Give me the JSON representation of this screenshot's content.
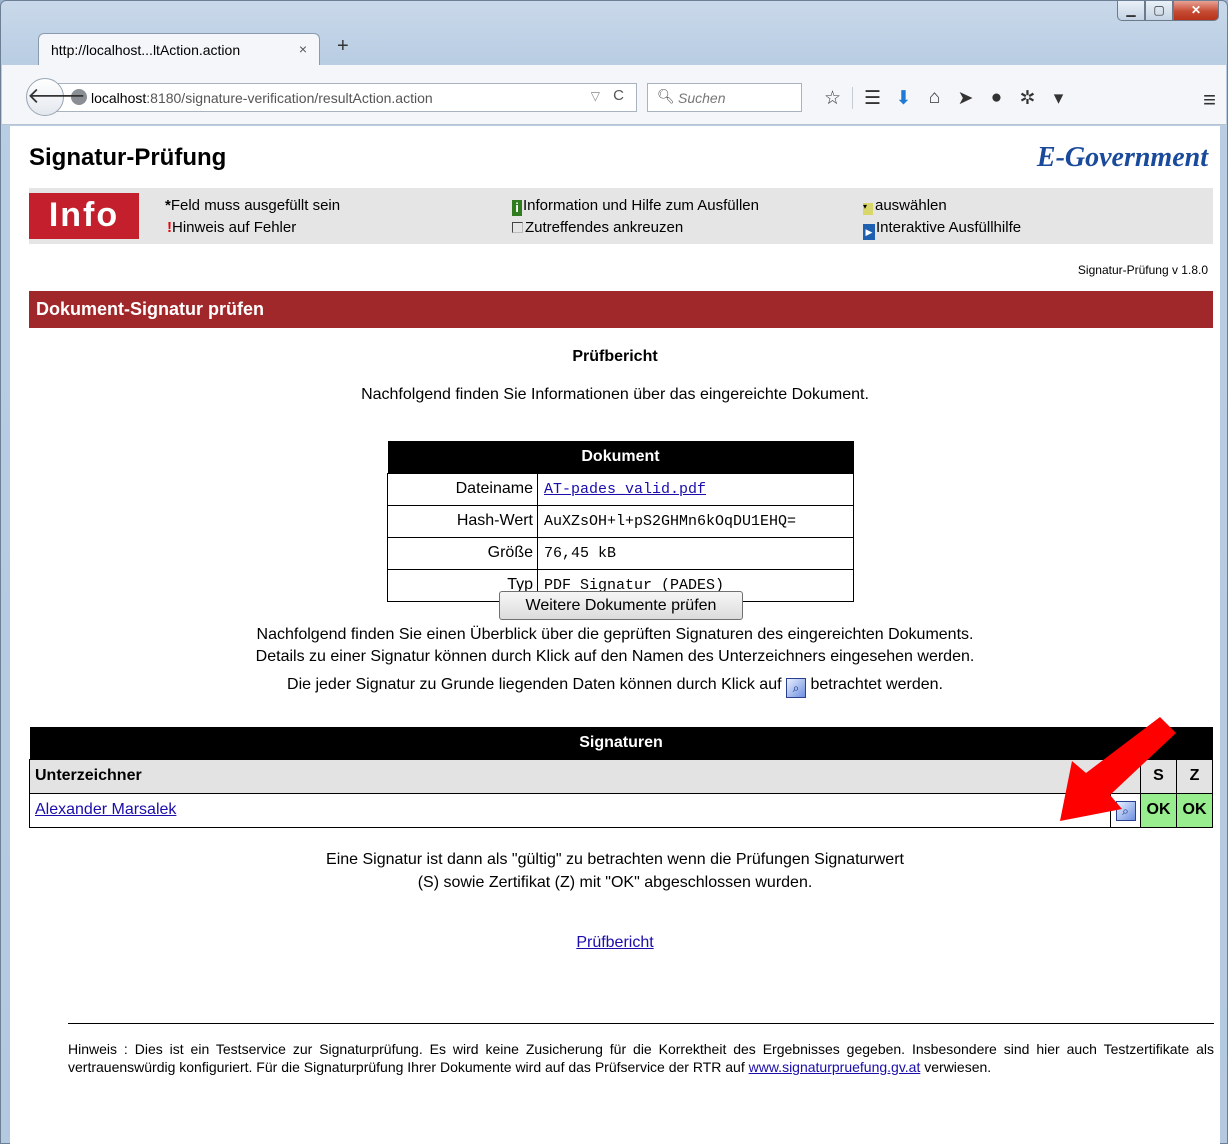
{
  "browser": {
    "tab_title": "http://localhost...ltAction.action",
    "tab_close": "×",
    "new_tab": "+",
    "url_host": "localhost",
    "url_rest": ":8180/signature-verification/resultAction.action",
    "search_placeholder": "Suchen"
  },
  "page": {
    "title": "Signatur-Prüfung",
    "brand": "E-Government",
    "info_logo": "Info",
    "legend": {
      "required": "Feld muss ausgefüllt sein",
      "error": "Hinweis auf Fehler",
      "info_help": "Information und Hilfe zum Ausfüllen",
      "checkbox": "Zutreffendes ankreuzen",
      "select": "auswählen",
      "interactive": "Interaktive Ausfüllhilfe"
    },
    "version": "Signatur-Prüfung v 1.8.0",
    "section_title": "Dokument-Signatur prüfen",
    "report_heading": "Prüfbericht",
    "intro": "Nachfolgend finden Sie Informationen über das eingereichte Dokument.",
    "document": {
      "header": "Dokument",
      "rows": [
        {
          "key": "Dateiname",
          "value": "AT-pades_valid.pdf"
        },
        {
          "key": "Hash-Wert",
          "value": "AuXZsOH+l+pS2GHMn6kOqDU1EHQ="
        },
        {
          "key": "Größe",
          "value": "76,45 kB"
        },
        {
          "key": "Typ",
          "value": "PDF Signatur (PADES)"
        }
      ]
    },
    "overview_line1": "Nachfolgend finden Sie einen Überblick über die geprüften Signaturen des eingereichten Dokuments.",
    "overview_line2": "Details zu einer Signatur können durch Klick auf den Namen des Unterzeichners eingesehen werden.",
    "overview_line3a": "Die jeder Signatur zu Grunde liegenden Daten können durch Klick auf",
    "overview_line3b": "betrachtet werden.",
    "signatures": {
      "header": "Signaturen",
      "col_signer": "Unterzeichner",
      "col_s": "S",
      "col_z": "Z",
      "rows": [
        {
          "signer": "Alexander Marsalek",
          "s": "OK",
          "z": "OK"
        }
      ]
    },
    "valid_note_line1": "Eine Signatur ist dann als \"gültig\" zu betrachten wenn die Prüfungen Signaturwert",
    "valid_note_line2": "(S) sowie Zertifikat (Z) mit \"OK\" abgeschlossen wurden.",
    "report_link": "Prüfbericht",
    "more_button": "Weitere Dokumente prüfen",
    "footer_text": "Hinweis : Dies ist ein Testservice zur Signaturprüfung. Es wird keine Zusicherung für die Korrektheit des Ergebnisses gegeben. Insbesondere sind hier auch Testzertifikate als vertrauenswürdig konfiguriert. Für die Signaturprüfung Ihrer Dokumente wird auf das Prüfservice der RTR auf",
    "footer_link": "www.signaturpruefung.gv.at",
    "footer_end": "verwiesen."
  },
  "colors": {
    "section_bg": "#a0282b",
    "info_logo_bg": "#c41f2c",
    "ok_bg": "#98ee8f",
    "brand": "#1a4a9b",
    "annotation_arrow": "#ff0000"
  }
}
